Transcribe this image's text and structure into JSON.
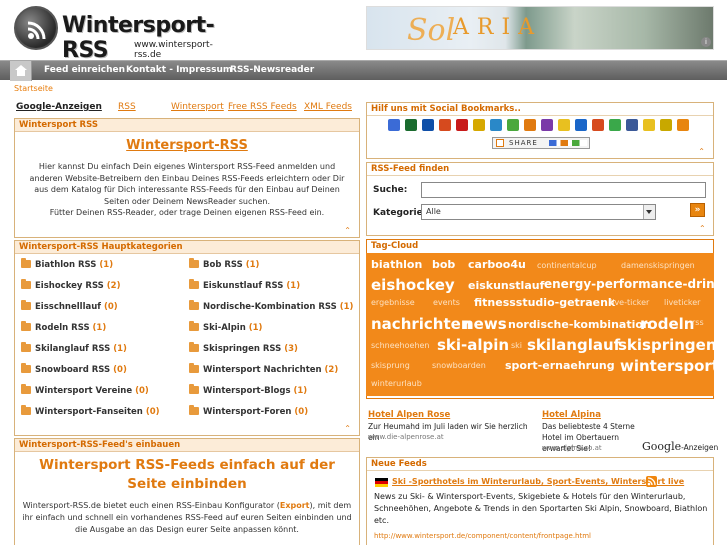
{
  "header": {
    "site_title": "Wintersport-RSS",
    "site_url": "www.wintersport-rss.de",
    "banner_text_sol": "Sol",
    "banner_text_aria": "ARIA",
    "banner_info": "i"
  },
  "nav": {
    "items": [
      "Feed einreichen",
      "Kontakt - Impressum",
      "RSS-Newsreader"
    ]
  },
  "breadcrumb": "Startseite",
  "tabs": [
    "Google-Anzeigen",
    "RSS",
    "Wintersport",
    "Free RSS Feeds",
    "XML Feeds"
  ],
  "intro": {
    "heading": "Wintersport RSS",
    "title_link": "Wintersport-RSS",
    "text": "Hier kannst Du einfach Dein eigenes Wintersport RSS-Feed anmelden und anderen Website-Betreibern den Einbau Deines RSS-Feeds erleichtern oder Dir aus dem Katalog für Dich interessante RSS-Feeds für den Einbau auf Deinen Seiten oder Deinem NewsReader suchen.",
    "text2": "Fütter Deinen RSS-Reader, oder trage Deinen eigenen RSS-Feed ein."
  },
  "categories": {
    "heading": "Wintersport-RSS Hauptkategorien",
    "left": [
      {
        "name": "Biathlon RSS",
        "count": "(1)"
      },
      {
        "name": "Eishockey RSS",
        "count": "(2)"
      },
      {
        "name": "Eisschnelllauf",
        "count": "(0)"
      },
      {
        "name": "Rodeln RSS",
        "count": "(1)"
      },
      {
        "name": "Skilanglauf RSS",
        "count": "(1)"
      },
      {
        "name": "Snowboard RSS",
        "count": "(0)"
      },
      {
        "name": "Wintersport Vereine",
        "count": "(0)"
      },
      {
        "name": "Wintersport-Fanseiten",
        "count": "(0)"
      }
    ],
    "right": [
      {
        "name": "Bob RSS",
        "count": "(1)"
      },
      {
        "name": "Eiskunstlauf RSS",
        "count": "(1)"
      },
      {
        "name": "Nordische-Kombination RSS",
        "count": "(1)"
      },
      {
        "name": "Ski-Alpin",
        "count": "(1)"
      },
      {
        "name": "Skispringen RSS",
        "count": "(3)"
      },
      {
        "name": "Wintersport Nachrichten",
        "count": "(2)"
      },
      {
        "name": "Wintersport-Blogs",
        "count": "(1)"
      },
      {
        "name": "Wintersport-Foren",
        "count": "(0)"
      }
    ]
  },
  "embed": {
    "heading": "Wintersport-RSS-Feed's einbauen",
    "title": "Wintersport RSS-Feeds einfach auf der Seite einbinden",
    "text_before": "Wintersport-RSS.de bietet euch einen RSS-Einbau Konfigurator (",
    "text_link": "Export",
    "text_after": "), mit dem ihr einfach und schnell ein vorhandenes RSS-Feed auf euren Seiten einbinden und die Ausgabe an das Design eurer Seite anpassen könnt."
  },
  "social": {
    "heading": "Hilf uns mit Social Bookmarks..",
    "share_label": "SHARE",
    "icons": [
      "google-icon",
      "digg-icon",
      "delicious-icon",
      "stumbleupon-icon",
      "heart-icon",
      "mister-wong-icon",
      "linkarena-icon",
      "technorati-icon",
      "folkd-icon",
      "yigg-icon",
      "star-icon",
      "windows-live-icon",
      "search-icon",
      "blue-dot-icon",
      "facebook-icon",
      "favorite-icon",
      "webnews-icon",
      "blogger-icon"
    ],
    "icon_colors": [
      "#3b6bd6",
      "#1a6b2e",
      "#0f4fa8",
      "#d64a1e",
      "#c81a1a",
      "#d6a800",
      "#2a88c8",
      "#4aa83c",
      "#e07a10",
      "#7a3aa8",
      "#e8c020",
      "#1a66c8",
      "#d64a1e",
      "#3aa84a",
      "#3b5998",
      "#e8c020",
      "#c8a800",
      "#e8850f"
    ]
  },
  "feed_search": {
    "heading": "RSS-Feed finden",
    "search_label": "Suche:",
    "category_label": "Kategorie:",
    "category_value": "Alle",
    "go_label": "»"
  },
  "tagcloud": {
    "heading": "Tag-Cloud",
    "tags": [
      {
        "t": "biathlon",
        "s": 11,
        "c": "#fff"
      },
      {
        "t": "bob",
        "s": 11,
        "c": "#fff"
      },
      {
        "t": "carboo4u",
        "s": 11,
        "c": "#fff"
      },
      {
        "t": "continentalcup",
        "s": 8,
        "c": "#fde1c0"
      },
      {
        "t": "damenskispringen",
        "s": 8,
        "c": "#fde1c0"
      },
      {
        "t": "eishockey",
        "s": 15,
        "c": "#fff"
      },
      {
        "t": "eiskunstlauf",
        "s": 11,
        "c": "#fff"
      },
      {
        "t": "energy-performance-drink",
        "s": 12,
        "c": "#fff"
      },
      {
        "t": "ergebnisse",
        "s": 8,
        "c": "#fde1c0"
      },
      {
        "t": "events",
        "s": 8,
        "c": "#fde1c0"
      },
      {
        "t": "fitnessstudio-getraenk",
        "s": 11,
        "c": "#fff"
      },
      {
        "t": "live-ticker",
        "s": 8,
        "c": "#fde1c0"
      },
      {
        "t": "liveticker",
        "s": 8,
        "c": "#fde1c0"
      },
      {
        "t": "nachrichten",
        "s": 15,
        "c": "#fff"
      },
      {
        "t": "news",
        "s": 15,
        "c": "#fff"
      },
      {
        "t": "nordische-kombination",
        "s": 11,
        "c": "#fff"
      },
      {
        "t": "rodeln",
        "s": 15,
        "c": "#fff"
      },
      {
        "t": "rss",
        "s": 8,
        "c": "#fde1c0"
      },
      {
        "t": "schneehoehen",
        "s": 8,
        "c": "#fde1c0"
      },
      {
        "t": "ski-alpin",
        "s": 15,
        "c": "#fff"
      },
      {
        "t": "ski",
        "s": 8,
        "c": "#fde1c0"
      },
      {
        "t": "skilanglauf",
        "s": 15,
        "c": "#fff"
      },
      {
        "t": "skispringen",
        "s": 15,
        "c": "#fff"
      },
      {
        "t": "skisprung",
        "s": 8,
        "c": "#fde1c0"
      },
      {
        "t": "snowboarden",
        "s": 8,
        "c": "#fde1c0"
      },
      {
        "t": "sport-ernaehrung",
        "s": 11,
        "c": "#fff"
      },
      {
        "t": "wintersport",
        "s": 15,
        "c": "#fff"
      },
      {
        "t": "winterurlaub",
        "s": 8,
        "c": "#fde1c0"
      }
    ]
  },
  "ads": [
    {
      "title": "Hotel Alpen Rose",
      "text": "Zur Heumahd im Juli laden wir Sie herzlich ein",
      "url": "www.die-alpenrose.at"
    },
    {
      "title": "Hotel Alpina",
      "text": "Das beliebteste 4 Sterne Hotel im Obertauern erwartet Sie!",
      "url": "www.alpina.co.at"
    }
  ],
  "google_ads_label": "Google",
  "google_ads_suffix": "-Anzeigen",
  "news": {
    "heading": "Neue Feeds",
    "item_title": "Ski -Sporthotels im Winterurlaub, Sport-Events, Wintersport live",
    "item_text": "News zu Ski- & Wintersport-Events, Skigebiete & Hotels für den Winterurlaub, Schneehöhen, Angebote & Trends in den Sportarten Ski Alpin, Snowboard, Biathlon etc.",
    "item_url": "http://www.wintersport.de/component/content/frontpage.html"
  },
  "colors": {
    "accent": "#e07a10",
    "tagcloud_bg": "#f2891a",
    "nav_bg": "#6e6e6e"
  }
}
